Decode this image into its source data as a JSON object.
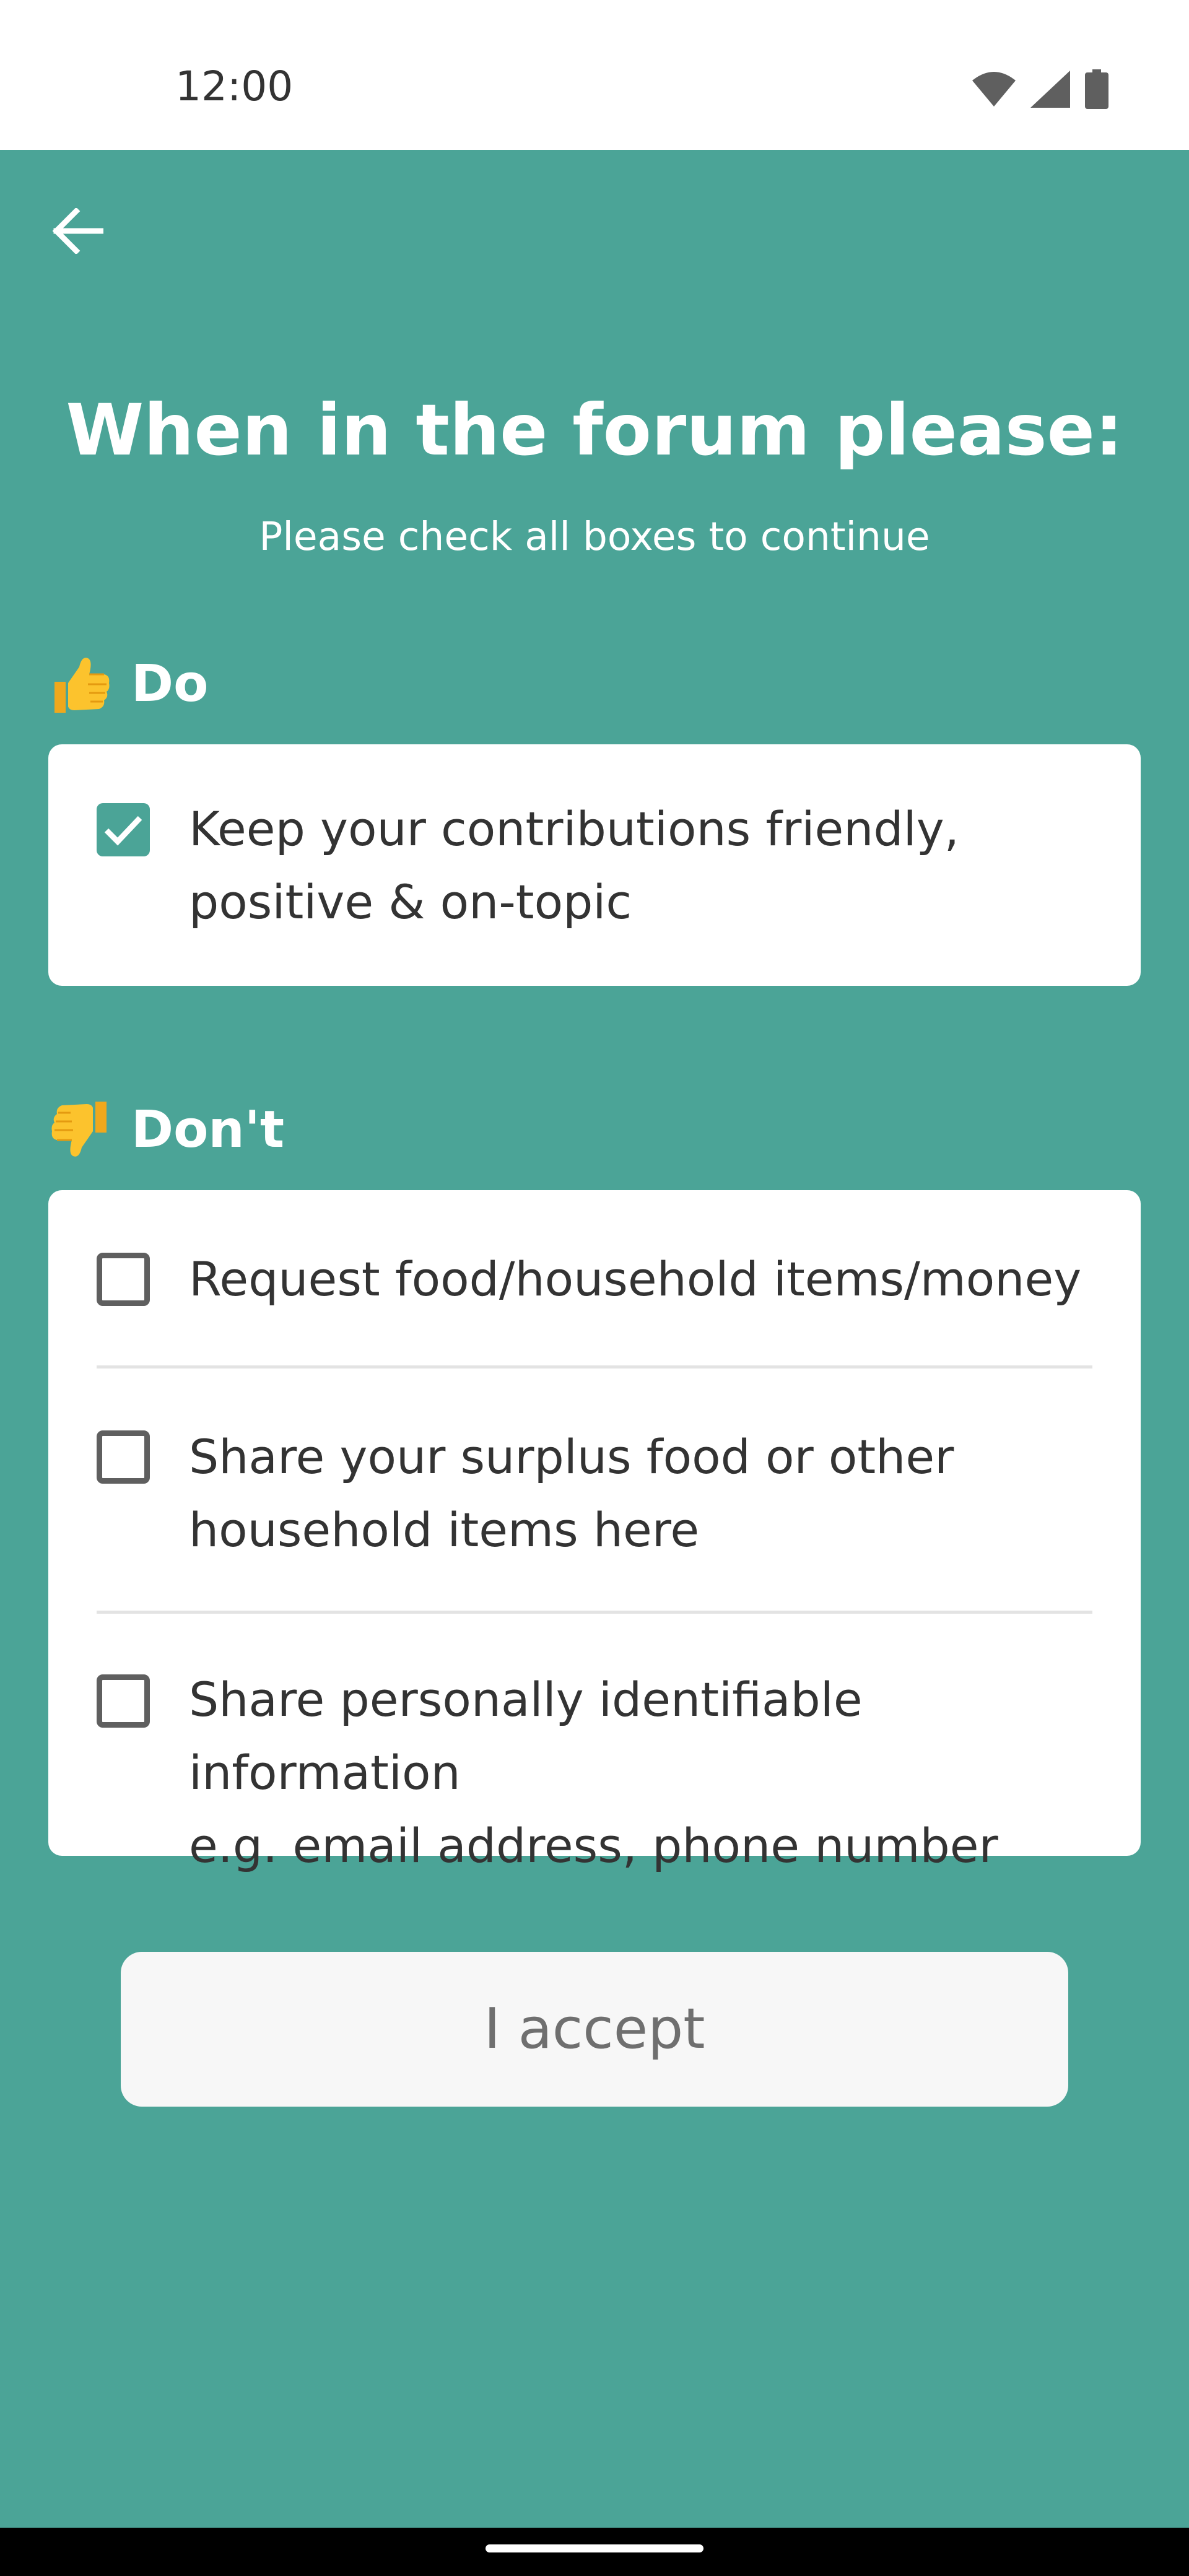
{
  "status_bar": {
    "time": "12:00",
    "icons": [
      "wifi-icon",
      "cell-signal-icon",
      "battery-icon"
    ]
  },
  "app_bar": {
    "back_icon": "arrow-left-icon"
  },
  "header": {
    "title": "When in the forum please:",
    "subtitle": "Please check all boxes to continue"
  },
  "do_section": {
    "emoji": "thumbs-up-icon",
    "heading": "Do",
    "items": [
      {
        "line1": "Keep your contributions friendly,",
        "line2": "positive & on-topic",
        "checked": true
      }
    ]
  },
  "dont_section": {
    "emoji": "thumbs-down-icon",
    "heading": "Don't",
    "items": [
      {
        "line1": "Request food/household items/money",
        "line2": "",
        "checked": false
      },
      {
        "line1": "Share your surplus food or other",
        "line2": "household items here",
        "checked": false
      },
      {
        "line1": "Share personally identifiable information",
        "line2": "e.g. email address, phone number",
        "checked": false
      }
    ]
  },
  "accept_button": {
    "label": "I accept"
  },
  "colors": {
    "background": "#4ba497",
    "card": "#ffffff",
    "text": "#333333",
    "button": "#f7f7f7",
    "button_text": "#6f6f6f"
  }
}
